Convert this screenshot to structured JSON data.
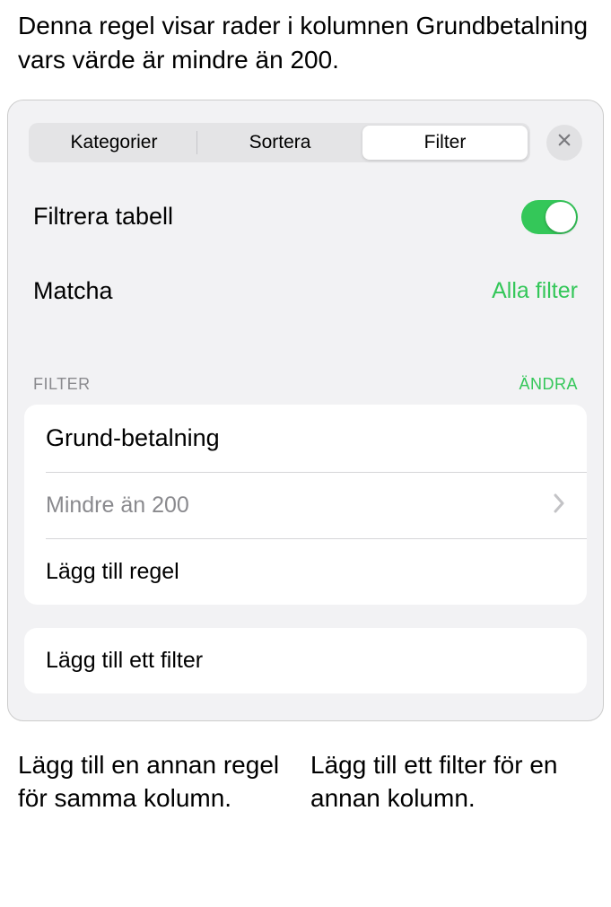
{
  "annotations": {
    "top": "Denna regel visar rader i kolumnen Grundbetalning vars värde är mindre än 200.",
    "bottom_left": "Lägg till en annan regel för samma kolumn.",
    "bottom_right": "Lägg till ett filter för en annan kolumn."
  },
  "tabs": {
    "categories": "Kategorier",
    "sort": "Sortera",
    "filter": "Filter"
  },
  "filter_table": {
    "label": "Filtrera tabell",
    "enabled": true
  },
  "match": {
    "label": "Matcha",
    "value": "Alla filter"
  },
  "section": {
    "header": "FILTER",
    "action": "ÄNDRA"
  },
  "rule": {
    "column": "Grund-betalning",
    "condition": "Mindre än 200",
    "add_rule": "Lägg till regel"
  },
  "add_filter": "Lägg till ett filter"
}
